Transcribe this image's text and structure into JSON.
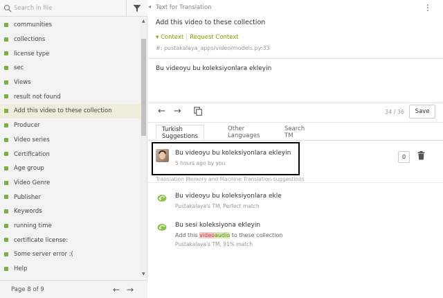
{
  "sidebar": {
    "search_placeholder": "Search in file",
    "items": [
      {
        "label": "communities"
      },
      {
        "label": "collections"
      },
      {
        "label": "license type"
      },
      {
        "label": "sec"
      },
      {
        "label": "Views"
      },
      {
        "label": "result not found"
      },
      {
        "label": "Add this video to these collection",
        "active": true
      },
      {
        "label": "Producer"
      },
      {
        "label": "Video series"
      },
      {
        "label": "Certification"
      },
      {
        "label": "Age group"
      },
      {
        "label": "Video Genre"
      },
      {
        "label": "Publisher"
      },
      {
        "label": "Keywords"
      },
      {
        "label": "running time"
      },
      {
        "label": "certificate license:"
      },
      {
        "label": "Some server error :("
      },
      {
        "label": "Help"
      }
    ],
    "pager_label": "Page 8 of 9",
    "accent_color": "#78b13f"
  },
  "editor": {
    "header_title": "Text for Translation",
    "source_text": "Add this video to these collection",
    "context_label": "Context",
    "request_context_label": "Request Context",
    "filepath": "#: pustakalaya_apps/video/models.py:33",
    "translation": "Bu videoyu bu koleksiyonlara ekleyin",
    "counter": "34 / 36",
    "save_label": "Save"
  },
  "tabs": [
    {
      "label": "Turkish Suggestions",
      "active": true
    },
    {
      "label": "Other Languages"
    },
    {
      "label": "Search TM"
    }
  ],
  "suggestion": {
    "text": "Bu videoyu bu koleksiyonlara ekleyin",
    "meta": "5 hours ago by you",
    "votes": "0"
  },
  "tm": {
    "header": "Translation Memory and Machine Translation suggestions",
    "items": [
      {
        "text": "Bu videoyu bu koleksiyonlara ekle",
        "meta": "Pustakalaya's TM, Perfect match"
      },
      {
        "text": "Bu sesi koleksiyona ekleyin",
        "source_prefix": "Add this ",
        "source_del": "video",
        "source_ins": "audio",
        "source_suffix": " to these collection",
        "meta": "Pustakalaya's TM, 91% match"
      }
    ]
  }
}
